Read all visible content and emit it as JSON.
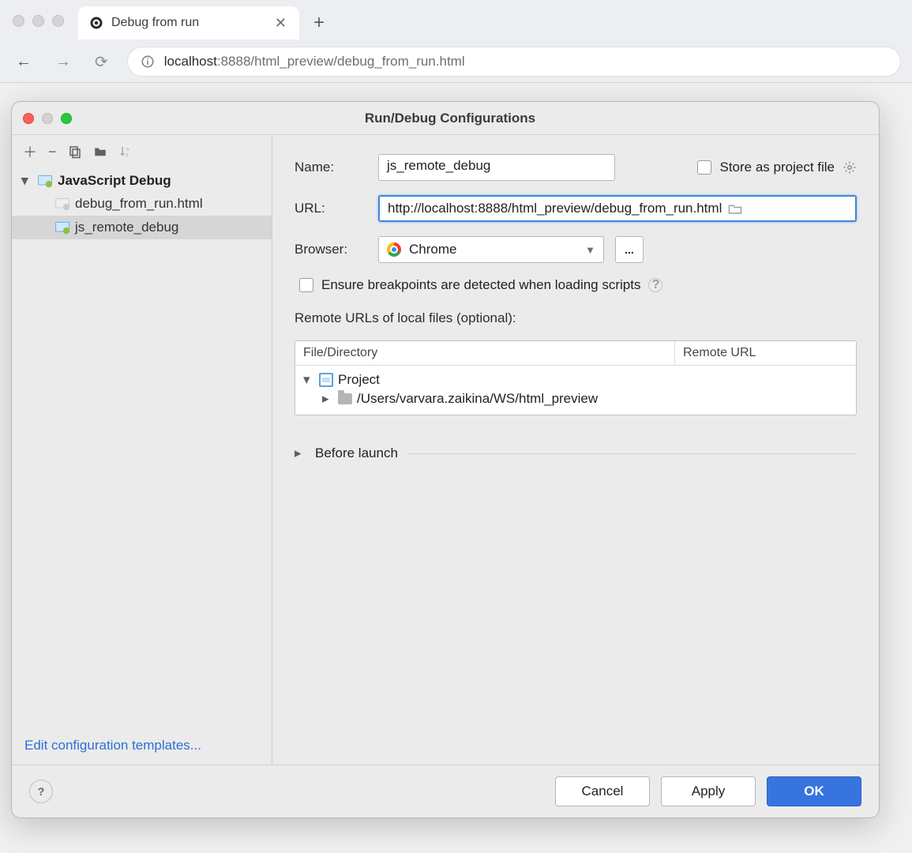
{
  "browser": {
    "tab_title": "Debug from run",
    "url_host": "localhost",
    "url_rest": ":8888/html_preview/debug_from_run.html"
  },
  "dialog": {
    "title": "Run/Debug Configurations"
  },
  "tree": {
    "group_label": "JavaScript Debug",
    "items": [
      {
        "label": "debug_from_run.html"
      },
      {
        "label": "js_remote_debug"
      }
    ]
  },
  "templates_link": "Edit configuration templates...",
  "form": {
    "name_label": "Name:",
    "name_value": "js_remote_debug",
    "store_label": "Store as project file",
    "url_label": "URL:",
    "url_value": "http://localhost:8888/html_preview/debug_from_run.html",
    "browser_label": "Browser:",
    "browser_value": "Chrome",
    "more_label": "...",
    "ensure_label": "Ensure breakpoints are detected when loading scripts",
    "remote_header": "Remote URLs of local files (optional):",
    "table": {
      "col1": "File/Directory",
      "col2": "Remote URL",
      "project_label": "Project",
      "path_label": "/Users/varvara.zaikina/WS/html_preview"
    },
    "before_launch_label": "Before launch"
  },
  "footer": {
    "cancel": "Cancel",
    "apply": "Apply",
    "ok": "OK"
  }
}
